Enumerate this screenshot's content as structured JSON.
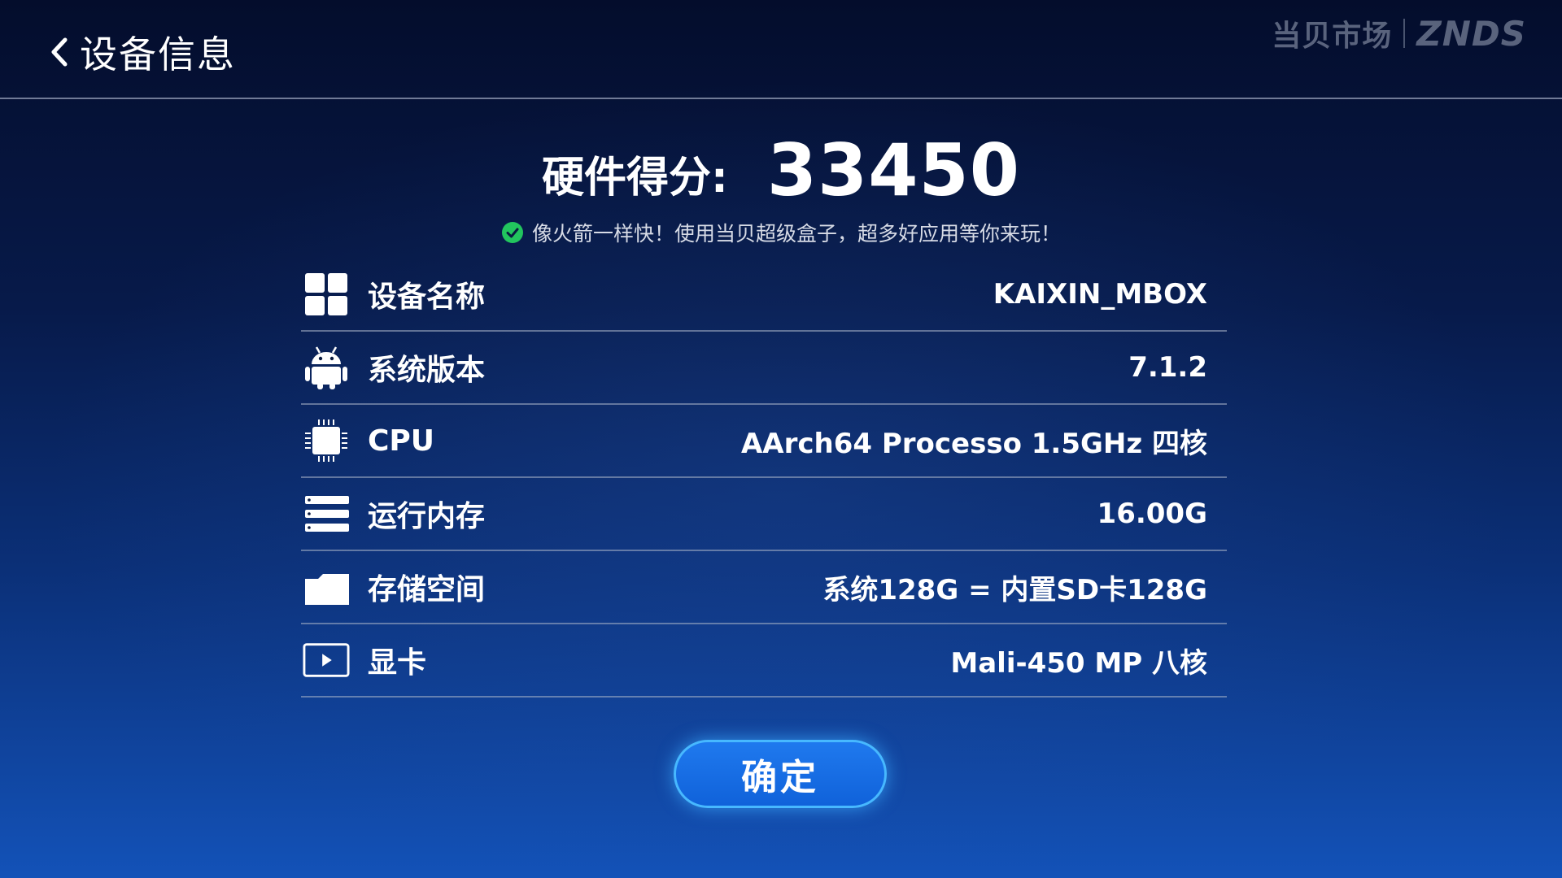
{
  "header": {
    "title": "设备信息",
    "back_icon": "chevron-left-icon",
    "brand_cn": "当贝市场",
    "brand_en": "ZNDS"
  },
  "score": {
    "label": "硬件得分:",
    "value": "33450",
    "tip": "像火箭一样快！使用当贝超级盒子，超多好应用等你来玩！",
    "tip_icon": "check-circle-icon",
    "tip_icon_color": "#22c55e"
  },
  "rows": [
    {
      "icon": "grid-icon",
      "label": "设备名称",
      "value": "KAIXIN_MBOX"
    },
    {
      "icon": "android-icon",
      "label": "系统版本",
      "value": "7.1.2"
    },
    {
      "icon": "chip-icon",
      "label": "CPU",
      "value": "AArch64 Processo 1.5GHz 四核"
    },
    {
      "icon": "memory-icon",
      "label": "运行内存",
      "value": "16.00G"
    },
    {
      "icon": "folder-icon",
      "label": "存储空间",
      "value": "系统128G = 内置SD卡128G"
    },
    {
      "icon": "video-play-icon",
      "label": "显卡",
      "value": "Mali-450 MP 八核"
    }
  ],
  "confirm_button": {
    "label": "确定"
  },
  "colors": {
    "accent": "#1a6fe8",
    "button_border": "#47b8ff",
    "background_top": "#040d2c",
    "background_bottom": "#1352b8"
  }
}
